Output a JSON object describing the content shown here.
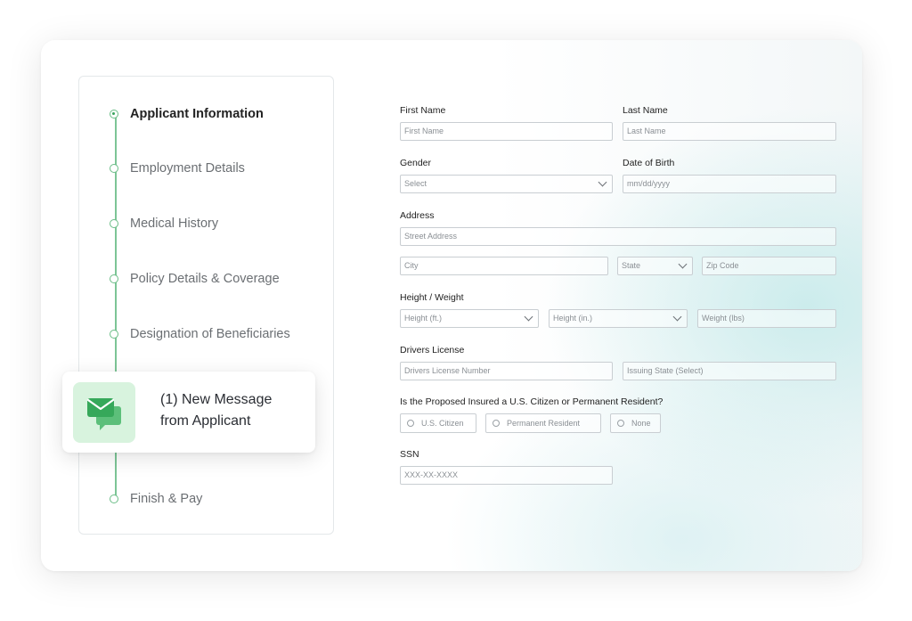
{
  "steps": [
    {
      "label": "Applicant Information",
      "active": true
    },
    {
      "label": "Employment Details",
      "active": false
    },
    {
      "label": "Medical History",
      "active": false
    },
    {
      "label": "Policy Details & Coverage",
      "active": false
    },
    {
      "label": "Designation of Beneficiaries",
      "active": false
    },
    {
      "label": "Finish & Pay",
      "active": false
    }
  ],
  "notification": {
    "line1": "(1) New Message",
    "line2": "from Applicant",
    "icon": "message-envelope-icon"
  },
  "form": {
    "first_name": {
      "label": "First Name",
      "placeholder": "First Name"
    },
    "last_name": {
      "label": "Last Name",
      "placeholder": "Last Name"
    },
    "gender": {
      "label": "Gender",
      "placeholder": "Select"
    },
    "dob": {
      "label": "Date of Birth",
      "placeholder": "mm/dd/yyyy"
    },
    "address": {
      "label": "Address",
      "street": "Street Address",
      "city": "City",
      "state": "State",
      "zip": "Zip Code"
    },
    "height_weight": {
      "label": "Height / Weight",
      "height_ft": "Height (ft.)",
      "height_in": "Height (in.)",
      "weight": "Weight (lbs)"
    },
    "license": {
      "label": "Drivers License",
      "number": "Drivers License Number",
      "state": "Issuing State (Select)"
    },
    "citizenship": {
      "label": "Is the Proposed Insured a U.S. Citizen or Permanent Resident?",
      "options": [
        "U.S. Citizen",
        "Permanent Resident",
        "None"
      ]
    },
    "ssn": {
      "label": "SSN",
      "placeholder": "XXX-XX-XXXX"
    }
  },
  "colors": {
    "accent_green": "#6bbd87",
    "icon_bg": "#d8f3de",
    "icon_green": "#3aa35e"
  }
}
